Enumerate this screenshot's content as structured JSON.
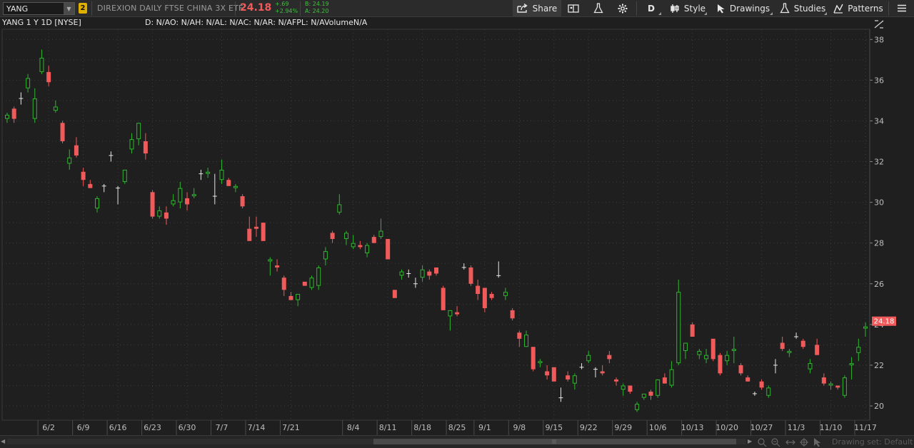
{
  "toolbar": {
    "symbol": "YANG",
    "link_badge": "2",
    "description": "DIREXION DAILY FTSE CHINA 3X ETF",
    "last_price": "24.18",
    "net_change": "+.69",
    "pct_change": "+2.94%",
    "bid": "B: 24.19",
    "ask": "A: 24.20",
    "share_label": "Share",
    "aggregation_label": "D",
    "style_label": "Style",
    "drawings_label": "Drawings",
    "studies_label": "Studies",
    "patterns_label": "Patterns",
    "icons": [
      "share-icon",
      "compare-icon",
      "flask-icon",
      "gear-icon",
      "style-icon",
      "cursor-icon",
      "studies-flask-icon",
      "patterns-icon",
      "menu-icon"
    ]
  },
  "chart_header": {
    "title": "YANG 1 Y 1D [NYSE]",
    "studies_line": "D: N/AO: N/AH: N/AL: N/AC: N/AR: N/AFPL: N/AVolumeN/A"
  },
  "bottom": {
    "drawing_set": "Drawing set: Default"
  },
  "colors": {
    "up": "#2fb52f",
    "down": "#f05a5a",
    "neutral": "#e6e6e6",
    "background": "#1f1f1f",
    "grid": "#3c3c3c",
    "price_tag": "#f05a5a"
  },
  "chart_data": {
    "type": "candlestick",
    "title": "YANG 1 Y 1D [NYSE]",
    "ylim": [
      19.3,
      38.5
    ],
    "y_ticks": [
      "20",
      "22",
      "24",
      "26",
      "28",
      "30",
      "32",
      "34",
      "36",
      "38"
    ],
    "x_ticks": [
      "6/2",
      "6/9",
      "6/16",
      "6/23",
      "6/30",
      "7/7",
      "7/14",
      "7/21",
      "8/4",
      "8/11",
      "8/18",
      "8/25",
      "9/1",
      "9/8",
      "9/15",
      "9/22",
      "9/29",
      "10/6",
      "10/13",
      "10/20",
      "10/27",
      "11/3",
      "11/10",
      "11/17"
    ],
    "current_price": "24.18",
    "grid": true,
    "candles": [
      {
        "o": 34.1,
        "h": 34.4,
        "l": 33.9,
        "c": 34.3
      },
      {
        "o": 34.6,
        "h": 34.7,
        "l": 33.9,
        "c": 34.1
      },
      {
        "o": 35.1,
        "h": 35.4,
        "l": 34.8,
        "c": 35.1
      },
      {
        "o": 35.6,
        "h": 36.3,
        "l": 35.4,
        "c": 36.1
      },
      {
        "o": 34.1,
        "h": 35.6,
        "l": 33.9,
        "c": 35.1
      },
      {
        "o": 36.4,
        "h": 37.5,
        "l": 36.3,
        "c": 37.1
      },
      {
        "o": 36.4,
        "h": 36.7,
        "l": 35.7,
        "c": 35.9
      },
      {
        "o": 34.5,
        "h": 35.0,
        "l": 34.4,
        "c": 34.7
      },
      {
        "o": 33.9,
        "h": 34.0,
        "l": 32.9,
        "c": 33.0
      },
      {
        "o": 31.9,
        "h": 32.6,
        "l": 31.6,
        "c": 32.2
      },
      {
        "o": 32.8,
        "h": 33.2,
        "l": 32.2,
        "c": 32.3
      },
      {
        "o": 31.5,
        "h": 31.7,
        "l": 30.8,
        "c": 31.1
      },
      {
        "o": 30.9,
        "h": 31.1,
        "l": 30.8,
        "c": 30.7
      },
      {
        "o": 29.7,
        "h": 30.3,
        "l": 29.5,
        "c": 30.2
      },
      {
        "o": 30.8,
        "h": 30.9,
        "l": 30.5,
        "c": 30.8
      },
      {
        "o": 32.3,
        "h": 32.5,
        "l": 32.0,
        "c": 32.3
      },
      {
        "o": 30.7,
        "h": 30.8,
        "l": 29.9,
        "c": 30.7
      },
      {
        "o": 31.0,
        "h": 31.6,
        "l": 30.9,
        "c": 31.6
      },
      {
        "o": 32.6,
        "h": 33.4,
        "l": 32.4,
        "c": 33.1
      },
      {
        "o": 33.1,
        "h": 33.9,
        "l": 32.8,
        "c": 33.9
      },
      {
        "o": 33.0,
        "h": 33.4,
        "l": 32.1,
        "c": 32.4
      },
      {
        "o": 30.5,
        "h": 30.6,
        "l": 29.2,
        "c": 29.3
      },
      {
        "o": 29.3,
        "h": 29.8,
        "l": 29.2,
        "c": 29.6
      },
      {
        "o": 29.5,
        "h": 29.8,
        "l": 28.9,
        "c": 29.2
      },
      {
        "o": 29.9,
        "h": 30.4,
        "l": 29.8,
        "c": 30.1
      },
      {
        "o": 30.0,
        "h": 31.0,
        "l": 29.7,
        "c": 30.7
      },
      {
        "o": 30.2,
        "h": 30.5,
        "l": 29.6,
        "c": 29.9
      },
      {
        "o": 30.3,
        "h": 30.7,
        "l": 30.2,
        "c": 30.4
      },
      {
        "o": 31.4,
        "h": 31.6,
        "l": 31.1,
        "c": 31.4
      },
      {
        "o": 31.4,
        "h": 31.7,
        "l": 31.2,
        "c": 31.5
      },
      {
        "o": 30.3,
        "h": 31.4,
        "l": 29.9,
        "c": 30.3
      },
      {
        "o": 31.1,
        "h": 32.1,
        "l": 30.9,
        "c": 31.6
      },
      {
        "o": 31.1,
        "h": 31.2,
        "l": 30.8,
        "c": 30.8
      },
      {
        "o": 30.7,
        "h": 30.9,
        "l": 30.5,
        "c": 30.8
      },
      {
        "o": 30.3,
        "h": 30.4,
        "l": 29.7,
        "c": 29.8
      },
      {
        "o": 28.7,
        "h": 29.3,
        "l": 28.2,
        "c": 28.1
      },
      {
        "o": 28.8,
        "h": 29.3,
        "l": 28.3,
        "c": 28.7
      },
      {
        "o": 29.0,
        "h": 29.0,
        "l": 28.1,
        "c": 28.1
      },
      {
        "o": 27.1,
        "h": 27.3,
        "l": 26.4,
        "c": 27.2
      },
      {
        "o": 26.9,
        "h": 27.2,
        "l": 26.6,
        "c": 26.8
      },
      {
        "o": 26.3,
        "h": 26.4,
        "l": 25.4,
        "c": 25.7
      },
      {
        "o": 25.4,
        "h": 25.6,
        "l": 25.3,
        "c": 25.2
      },
      {
        "o": 25.2,
        "h": 25.5,
        "l": 24.9,
        "c": 25.5
      },
      {
        "o": 26.1,
        "h": 26.1,
        "l": 25.9,
        "c": 25.9
      },
      {
        "o": 25.8,
        "h": 26.4,
        "l": 25.7,
        "c": 26.3
      },
      {
        "o": 25.9,
        "h": 26.9,
        "l": 25.7,
        "c": 26.8
      },
      {
        "o": 27.2,
        "h": 27.8,
        "l": 26.9,
        "c": 27.6
      },
      {
        "o": 28.5,
        "h": 28.6,
        "l": 28.0,
        "c": 28.2
      },
      {
        "o": 29.5,
        "h": 30.4,
        "l": 29.4,
        "c": 29.9
      },
      {
        "o": 28.2,
        "h": 28.6,
        "l": 27.9,
        "c": 28.5
      },
      {
        "o": 27.8,
        "h": 28.4,
        "l": 27.7,
        "c": 28.0
      },
      {
        "o": 27.9,
        "h": 28.1,
        "l": 27.7,
        "c": 27.8
      },
      {
        "o": 27.5,
        "h": 28.0,
        "l": 27.3,
        "c": 27.9
      },
      {
        "o": 28.3,
        "h": 28.4,
        "l": 28.0,
        "c": 28.0
      },
      {
        "o": 28.3,
        "h": 29.2,
        "l": 28.2,
        "c": 28.6
      },
      {
        "o": 28.2,
        "h": 28.2,
        "l": 27.3,
        "c": 27.2
      },
      {
        "o": 25.7,
        "h": 25.7,
        "l": 25.3,
        "c": 25.3
      },
      {
        "o": 26.4,
        "h": 26.7,
        "l": 26.2,
        "c": 26.6
      },
      {
        "o": 26.5,
        "h": 26.7,
        "l": 26.3,
        "c": 26.5
      },
      {
        "o": 26.0,
        "h": 26.3,
        "l": 25.8,
        "c": 26.0
      },
      {
        "o": 26.3,
        "h": 26.9,
        "l": 26.1,
        "c": 26.7
      },
      {
        "o": 26.6,
        "h": 26.7,
        "l": 26.2,
        "c": 26.4
      },
      {
        "o": 26.8,
        "h": 26.8,
        "l": 26.4,
        "c": 26.5
      },
      {
        "o": 25.8,
        "h": 25.9,
        "l": 24.8,
        "c": 24.7
      },
      {
        "o": 24.4,
        "h": 24.7,
        "l": 23.7,
        "c": 24.7
      },
      {
        "o": 24.6,
        "h": 24.9,
        "l": 24.4,
        "c": 24.5
      },
      {
        "o": 26.8,
        "h": 27.0,
        "l": 26.7,
        "c": 26.8
      },
      {
        "o": 26.8,
        "h": 26.9,
        "l": 25.9,
        "c": 26.0
      },
      {
        "o": 25.9,
        "h": 26.2,
        "l": 25.2,
        "c": 25.5
      },
      {
        "o": 25.8,
        "h": 25.8,
        "l": 24.6,
        "c": 24.8
      },
      {
        "o": 25.5,
        "h": 25.6,
        "l": 25.2,
        "c": 25.3
      },
      {
        "o": 26.4,
        "h": 27.1,
        "l": 26.3,
        "c": 26.4
      },
      {
        "o": 25.4,
        "h": 25.8,
        "l": 25.2,
        "c": 25.6
      },
      {
        "o": 24.7,
        "h": 24.8,
        "l": 24.2,
        "c": 24.3
      },
      {
        "o": 23.6,
        "h": 23.7,
        "l": 22.9,
        "c": 23.3
      },
      {
        "o": 22.9,
        "h": 23.7,
        "l": 22.9,
        "c": 23.5
      },
      {
        "o": 22.9,
        "h": 22.9,
        "l": 21.7,
        "c": 21.8
      },
      {
        "o": 22.1,
        "h": 22.3,
        "l": 21.9,
        "c": 22.2
      },
      {
        "o": 21.7,
        "h": 22.0,
        "l": 21.3,
        "c": 21.5
      },
      {
        "o": 21.9,
        "h": 21.9,
        "l": 21.2,
        "c": 21.2
      },
      {
        "o": 20.4,
        "h": 20.9,
        "l": 20.2,
        "c": 20.4
      },
      {
        "o": 21.5,
        "h": 21.7,
        "l": 21.2,
        "c": 21.3
      },
      {
        "o": 21.1,
        "h": 21.6,
        "l": 20.8,
        "c": 21.5
      },
      {
        "o": 21.9,
        "h": 22.1,
        "l": 21.8,
        "c": 21.9
      },
      {
        "o": 22.2,
        "h": 22.7,
        "l": 22.1,
        "c": 22.5
      },
      {
        "o": 21.8,
        "h": 21.9,
        "l": 21.4,
        "c": 21.8
      },
      {
        "o": 21.7,
        "h": 22.0,
        "l": 21.5,
        "c": 21.6
      },
      {
        "o": 22.5,
        "h": 22.7,
        "l": 22.1,
        "c": 22.3
      },
      {
        "o": 21.3,
        "h": 21.4,
        "l": 21.0,
        "c": 21.2
      },
      {
        "o": 20.8,
        "h": 21.1,
        "l": 20.5,
        "c": 21.0
      },
      {
        "o": 21.0,
        "h": 21.0,
        "l": 20.6,
        "c": 20.7
      },
      {
        "o": 19.8,
        "h": 20.2,
        "l": 19.7,
        "c": 20.1
      },
      {
        "o": 20.4,
        "h": 20.6,
        "l": 20.3,
        "c": 20.6
      },
      {
        "o": 20.7,
        "h": 20.8,
        "l": 20.3,
        "c": 20.5
      },
      {
        "o": 20.5,
        "h": 21.3,
        "l": 20.4,
        "c": 21.3
      },
      {
        "o": 21.4,
        "h": 21.6,
        "l": 21.1,
        "c": 21.1
      },
      {
        "o": 21.0,
        "h": 22.2,
        "l": 20.9,
        "c": 21.8
      },
      {
        "o": 22.1,
        "h": 26.2,
        "l": 22.0,
        "c": 25.6
      },
      {
        "o": 22.7,
        "h": 23.1,
        "l": 22.3,
        "c": 23.1
      },
      {
        "o": 24.0,
        "h": 24.1,
        "l": 23.4,
        "c": 23.4
      },
      {
        "o": 22.5,
        "h": 22.8,
        "l": 22.3,
        "c": 22.7
      },
      {
        "o": 22.3,
        "h": 22.8,
        "l": 22.1,
        "c": 22.5
      },
      {
        "o": 23.3,
        "h": 23.3,
        "l": 22.2,
        "c": 22.3
      },
      {
        "o": 22.5,
        "h": 22.6,
        "l": 21.5,
        "c": 21.6
      },
      {
        "o": 22.2,
        "h": 22.7,
        "l": 22.0,
        "c": 22.5
      },
      {
        "o": 22.7,
        "h": 23.4,
        "l": 22.1,
        "c": 22.8
      },
      {
        "o": 22.0,
        "h": 22.1,
        "l": 21.5,
        "c": 21.6
      },
      {
        "o": 21.4,
        "h": 21.5,
        "l": 21.2,
        "c": 21.2
      },
      {
        "o": 20.6,
        "h": 20.7,
        "l": 20.5,
        "c": 20.6
      },
      {
        "o": 21.2,
        "h": 21.3,
        "l": 20.8,
        "c": 20.9
      },
      {
        "o": 20.5,
        "h": 21.0,
        "l": 20.4,
        "c": 20.9
      },
      {
        "o": 22.0,
        "h": 22.3,
        "l": 21.6,
        "c": 22.0
      },
      {
        "o": 23.1,
        "h": 23.4,
        "l": 22.7,
        "c": 22.8
      },
      {
        "o": 22.6,
        "h": 22.8,
        "l": 22.4,
        "c": 22.7
      },
      {
        "o": 23.4,
        "h": 23.6,
        "l": 23.3,
        "c": 23.4
      },
      {
        "o": 23.2,
        "h": 23.3,
        "l": 22.8,
        "c": 22.9
      },
      {
        "o": 21.8,
        "h": 22.3,
        "l": 21.6,
        "c": 22.1
      },
      {
        "o": 23.0,
        "h": 23.3,
        "l": 22.5,
        "c": 22.5
      },
      {
        "o": 21.4,
        "h": 21.6,
        "l": 21.0,
        "c": 21.1
      },
      {
        "o": 21.0,
        "h": 21.2,
        "l": 20.8,
        "c": 21.1
      },
      {
        "o": 21.0,
        "h": 21.0,
        "l": 20.8,
        "c": 20.9
      },
      {
        "o": 20.5,
        "h": 21.5,
        "l": 20.4,
        "c": 21.4
      },
      {
        "o": 22.0,
        "h": 22.4,
        "l": 21.3,
        "c": 22.1
      },
      {
        "o": 22.6,
        "h": 23.3,
        "l": 22.2,
        "c": 22.9
      },
      {
        "o": 23.8,
        "h": 24.1,
        "l": 23.4,
        "c": 23.9
      }
    ]
  }
}
